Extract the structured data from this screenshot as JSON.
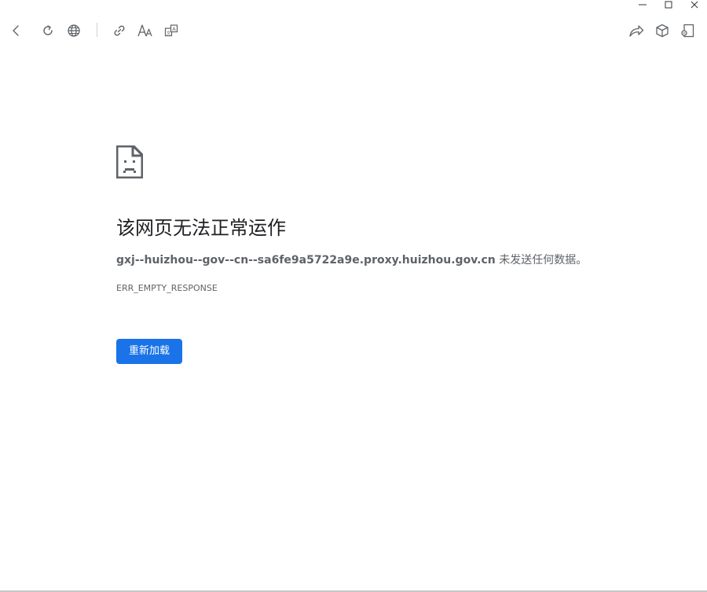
{
  "window_controls": {
    "minimize_icon": "minimize-icon",
    "maximize_icon": "maximize-icon",
    "close_icon": "close-icon"
  },
  "toolbar": {
    "left_icons": [
      "back-arrow-icon",
      "reload-icon",
      "globe-icon",
      "link-icon",
      "text-size-icon",
      "translate-icon"
    ],
    "right_icons": [
      "share-icon",
      "cube-icon",
      "window-icon"
    ]
  },
  "error_page": {
    "icon": "sad-document-icon",
    "title": "该网页无法正常运作",
    "host": "gxj--huizhou--gov--cn--sa6fe9a5722a9e.proxy.huizhou.gov.cn",
    "message_suffix": " 未发送任何数据。",
    "error_code": "ERR_EMPTY_RESPONSE",
    "reload_label": "重新加载"
  },
  "colors": {
    "accent": "#1a73e8",
    "title": "#202124",
    "secondary_text": "#5f6368",
    "icon": "#5f6368"
  }
}
